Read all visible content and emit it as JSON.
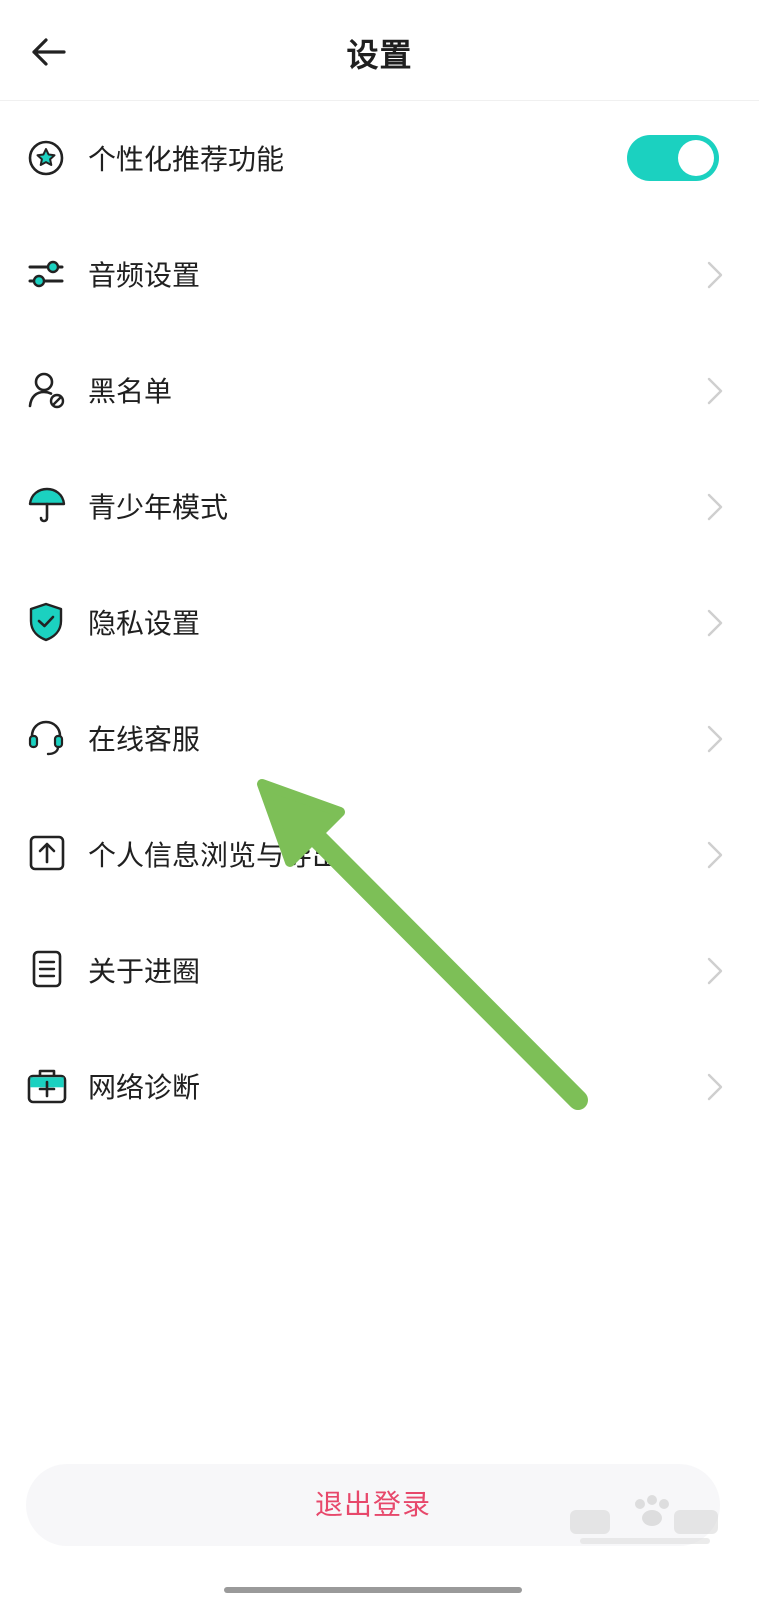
{
  "header": {
    "title": "设置",
    "back_icon": "arrow-left-icon"
  },
  "settings": {
    "items": [
      {
        "label": "个性化推荐功能",
        "icon": "star-badge-icon",
        "control": "toggle",
        "toggle_on": true
      },
      {
        "label": "音频设置",
        "icon": "sliders-icon",
        "control": "chevron"
      },
      {
        "label": "黑名单",
        "icon": "user-block-icon",
        "control": "chevron"
      },
      {
        "label": "青少年模式",
        "icon": "umbrella-icon",
        "control": "chevron"
      },
      {
        "label": "隐私设置",
        "icon": "shield-check-icon",
        "control": "chevron"
      },
      {
        "label": "在线客服",
        "icon": "headset-icon",
        "control": "chevron"
      },
      {
        "label": "个人信息浏览与导出",
        "icon": "upload-icon",
        "control": "chevron"
      },
      {
        "label": "关于进圈",
        "icon": "document-icon",
        "control": "chevron"
      },
      {
        "label": "网络诊断",
        "icon": "medkit-icon",
        "control": "chevron"
      }
    ]
  },
  "logout_label": "退出登录",
  "colors": {
    "accent": "#1bd1c0",
    "logout": "#e7486b",
    "annotation_arrow": "#7dbf57"
  }
}
